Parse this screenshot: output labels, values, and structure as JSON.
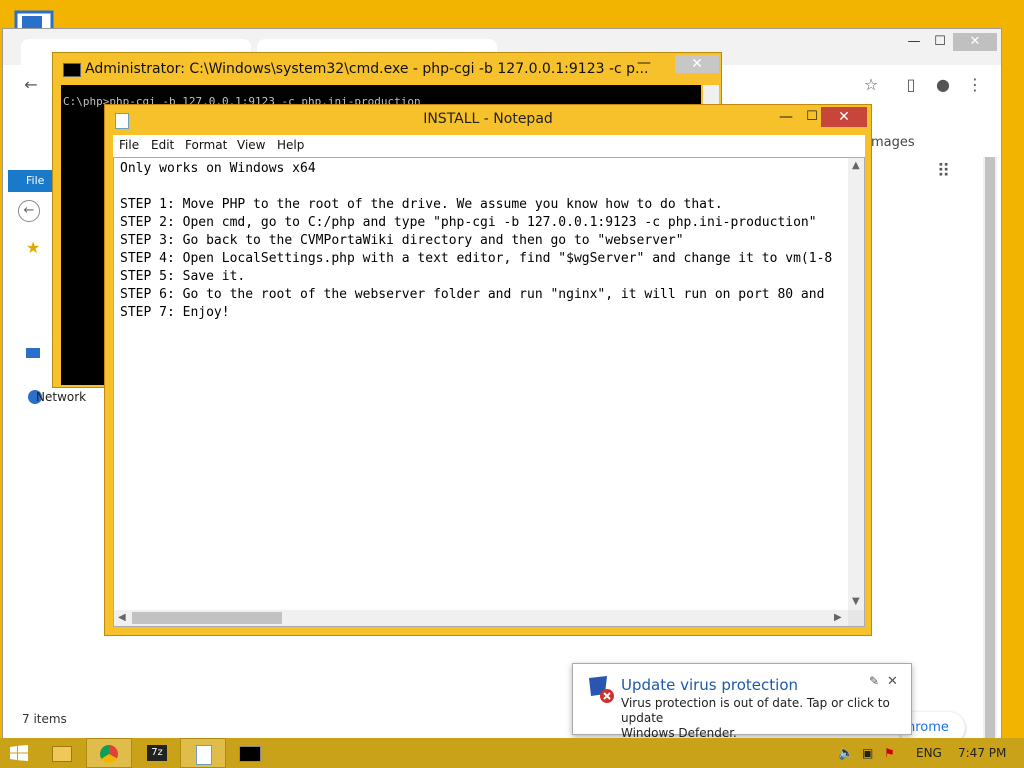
{
  "cmd": {
    "title": "Administrator: C:\\Windows\\system32\\cmd.exe - php-cgi  -b 127.0.0.1:9123 -c p...",
    "line": "C:\\php>php-cgi -b 127.0.0.1:9123 -c php.ini-production",
    "close": "✕",
    "min": "—"
  },
  "notepad": {
    "title": "INSTALL - Notepad",
    "menu": [
      "File",
      "Edit",
      "Format",
      "View",
      "Help"
    ],
    "content": "Only works on Windows x64\n\nSTEP 1: Move PHP to the root of the drive. We assume you know how to do that.\nSTEP 2: Open cmd, go to C:/php and type \"php-cgi -b 127.0.0.1:9123 -c php.ini-production\"\nSTEP 3: Go back to the CVMPortaWiki directory and then go to \"webserver\"\nSTEP 4: Open LocalSettings.php with a text editor, find \"$wgServer\" and change it to vm(1-8\nSTEP 5: Save it.\nSTEP 6: Go to the root of the webserver folder and run \"nginx\", it will run on port 80 and\nSTEP 7: Enjoy!",
    "min": "—",
    "max": "☐",
    "close": "✕"
  },
  "chrome": {
    "images_link": "mages",
    "pill_text": "hrome",
    "min": "—",
    "max": "☐",
    "close": "✕"
  },
  "explorer": {
    "file_tab": "File",
    "network": "Network",
    "items": "7 items"
  },
  "toast": {
    "title": "Update virus protection",
    "body_line1": "Virus protection is out of date. Tap or click to update",
    "body_line2": "Windows Defender."
  },
  "taskbar": {
    "lang": "ENG",
    "time": "7:47 PM"
  },
  "colors": {
    "desktop": "#f2b400",
    "accent": "#1979ca",
    "close_red": "#c7453a"
  }
}
